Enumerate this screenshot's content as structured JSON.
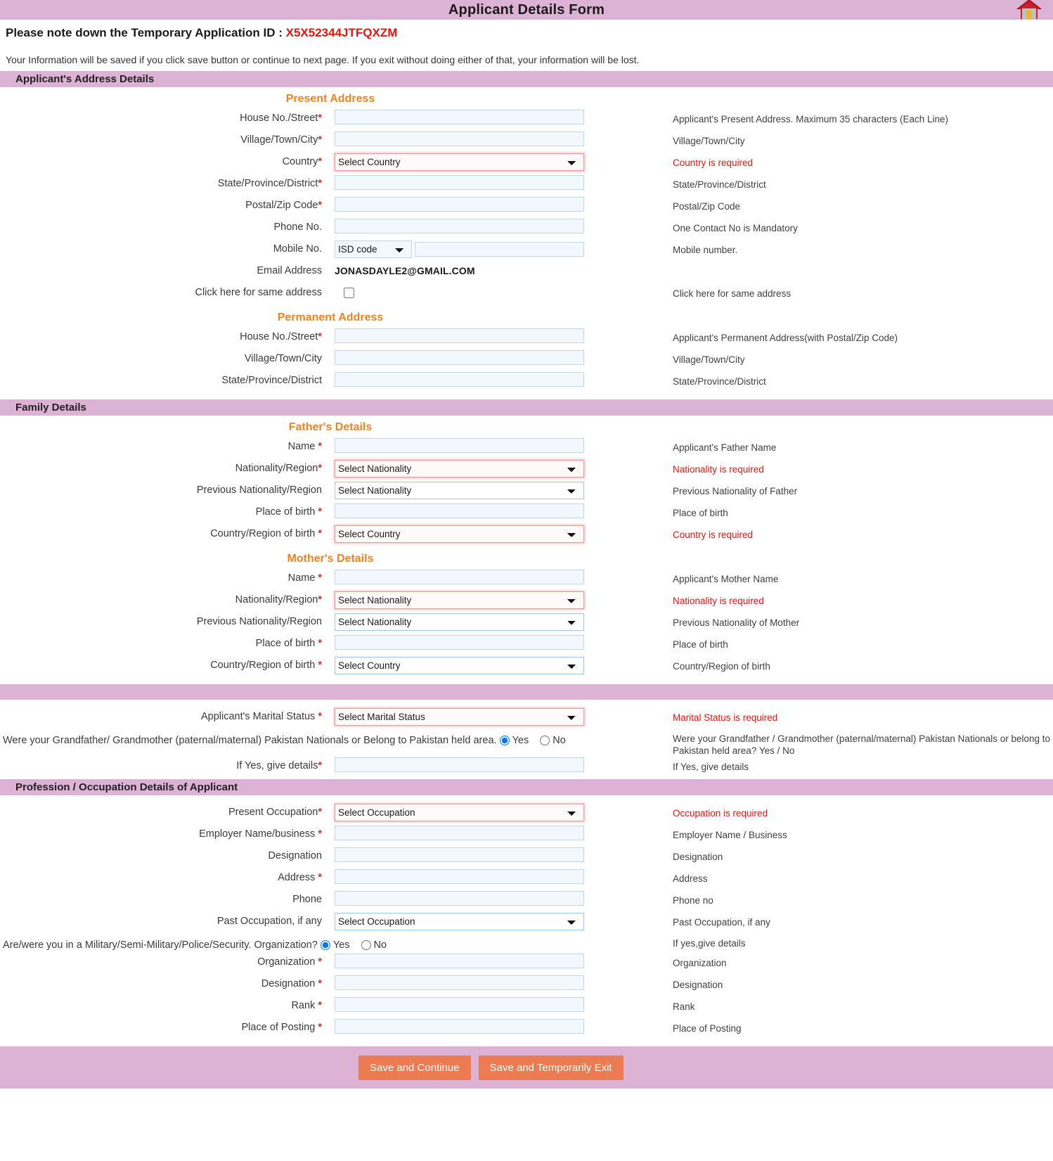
{
  "header": {
    "title": "Applicant Details Form",
    "home_icon": "home-icon"
  },
  "intro": {
    "temp_id_label": "Please note down the Temporary Application ID : ",
    "temp_id_value": "X5X52344JTFQXZM",
    "note": "Your Information will be saved if you click save button or continue to next page. If you exit without doing either of that, your information will be lost."
  },
  "colors": {
    "section_bar": "#ddb3d5",
    "subhead": "#f2821b",
    "error": "#e8130b",
    "button": "#ec7b52"
  },
  "sections": {
    "address": {
      "title": "Applicant's Address Details",
      "present_heading": "Present Address",
      "permanent_heading": "Permanent Address"
    },
    "family": {
      "title": "Family Details",
      "father_heading": "Father's Details",
      "mother_heading": "Mother's Details"
    },
    "marital": {
      "title": ""
    },
    "profession": {
      "title": "Profession / Occupation Details of Applicant"
    }
  },
  "present_address": {
    "house": {
      "label": "House No./Street",
      "required": true,
      "value": "",
      "hint": "Applicant's Present Address. Maximum 35 characters (Each Line)"
    },
    "village": {
      "label": "Village/Town/City",
      "required": true,
      "value": "",
      "hint": "Village/Town/City"
    },
    "country": {
      "label": "Country",
      "required": true,
      "selected": "Select Country",
      "hint": "Country is required",
      "hint_error": true,
      "invalid": true
    },
    "state": {
      "label": "State/Province/District",
      "required": true,
      "value": "",
      "hint": "State/Province/District"
    },
    "postal": {
      "label": "Postal/Zip Code",
      "required": true,
      "value": "",
      "hint": "Postal/Zip Code"
    },
    "phone": {
      "label": "Phone No.",
      "required": false,
      "value": "",
      "hint": "One Contact No is Mandatory"
    },
    "mobile": {
      "label": "Mobile No.",
      "required": false,
      "isd_selected": "ISD code",
      "value": "",
      "hint": "Mobile number."
    },
    "email": {
      "label": "Email Address",
      "value": "JONASDAYLE2@GMAIL.COM",
      "hint": ""
    },
    "same_address": {
      "label": "Click here for same address",
      "checked": false,
      "hint": "Click here for same address"
    }
  },
  "permanent_address": {
    "house": {
      "label": "House No./Street",
      "required": true,
      "value": "",
      "hint": "Applicant's Permanent Address(with Postal/Zip Code)"
    },
    "village": {
      "label": "Village/Town/City",
      "required": false,
      "value": "",
      "hint": "Village/Town/City"
    },
    "state": {
      "label": "State/Province/District",
      "required": false,
      "value": "",
      "hint": "State/Province/District"
    }
  },
  "father": {
    "name": {
      "label": "Name ",
      "required": true,
      "value": "",
      "hint": "Applicant's Father Name"
    },
    "nationality": {
      "label": "Nationality/Region",
      "required": true,
      "selected": "Select Nationality",
      "hint": "Nationality is required",
      "hint_error": true,
      "invalid": true
    },
    "prev_nationality": {
      "label": "Previous Nationality/Region",
      "required": false,
      "selected": "Select Nationality",
      "hint": "Previous Nationality of Father"
    },
    "place_of_birth": {
      "label": "Place of birth ",
      "required": true,
      "value": "",
      "hint": "Place of birth"
    },
    "country_of_birth": {
      "label": "Country/Region of birth ",
      "required": true,
      "selected": "Select Country",
      "hint": "Country is required",
      "hint_error": true,
      "invalid": true
    }
  },
  "mother": {
    "name": {
      "label": "Name ",
      "required": true,
      "value": "",
      "hint": "Applicant's Mother Name"
    },
    "nationality": {
      "label": "Nationality/Region",
      "required": true,
      "selected": "Select Nationality",
      "hint": "Nationality is required",
      "hint_error": true,
      "invalid": true
    },
    "prev_nationality": {
      "label": "Previous Nationality/Region",
      "required": false,
      "selected": "Select Nationality",
      "hint": "Previous Nationality of Mother"
    },
    "place_of_birth": {
      "label": "Place of birth ",
      "required": true,
      "value": "",
      "hint": "Place of birth"
    },
    "country_of_birth": {
      "label": "Country/Region of birth ",
      "required": true,
      "selected": "Select Country",
      "hint": "Country/Region of birth"
    }
  },
  "marital": {
    "status": {
      "label": "Applicant's Marital Status ",
      "required": true,
      "selected": "Select Marital Status",
      "hint": "Marital Status is required",
      "hint_error": true,
      "invalid": true
    },
    "grandparent_question": "Were your Grandfather/ Grandmother (paternal/maternal) Pakistan Nationals or Belong to Pakistan held area.",
    "grandparent_hint": "Were your Grandfather / Grandmother (paternal/maternal) Pakistan Nationals or belong to Pakistan held area? Yes / No",
    "yes_label": "Yes",
    "no_label": "No",
    "selected_option": "Yes",
    "details": {
      "label": "If Yes, give details",
      "required": true,
      "value": "",
      "hint": "If Yes, give details"
    }
  },
  "profession": {
    "present_occupation": {
      "label": "Present Occupation",
      "required": true,
      "selected": "Select Occupation",
      "hint": "Occupation is required",
      "hint_error": true,
      "invalid": true
    },
    "employer": {
      "label": "Employer Name/business ",
      "required": true,
      "value": "",
      "hint": "Employer Name / Business"
    },
    "designation": {
      "label": "Designation",
      "required": false,
      "value": "",
      "hint": "Designation"
    },
    "address": {
      "label": "Address ",
      "required": true,
      "value": "",
      "hint": "Address"
    },
    "phone": {
      "label": "Phone",
      "required": false,
      "value": "",
      "hint": "Phone no"
    },
    "past_occupation": {
      "label": "Past Occupation, if any",
      "required": false,
      "selected": "Select Occupation",
      "hint": "Past Occupation, if any"
    },
    "military_question": "Are/were you in a Military/Semi-Military/Police/Security. Organization?",
    "military_hint": "If yes,give details",
    "yes_label": "Yes",
    "no_label": "No",
    "selected_option": "Yes",
    "organization": {
      "label": "Organization ",
      "required": true,
      "value": "",
      "hint": "Organization"
    },
    "mil_designation": {
      "label": "Designation ",
      "required": true,
      "value": "",
      "hint": "Designation"
    },
    "rank": {
      "label": "Rank ",
      "required": true,
      "value": "",
      "hint": "Rank"
    },
    "place_of_posting": {
      "label": "Place of Posting ",
      "required": true,
      "value": "",
      "hint": "Place of Posting"
    }
  },
  "footer": {
    "save_continue": "Save and Continue",
    "save_exit": "Save and Temporarily Exit"
  }
}
